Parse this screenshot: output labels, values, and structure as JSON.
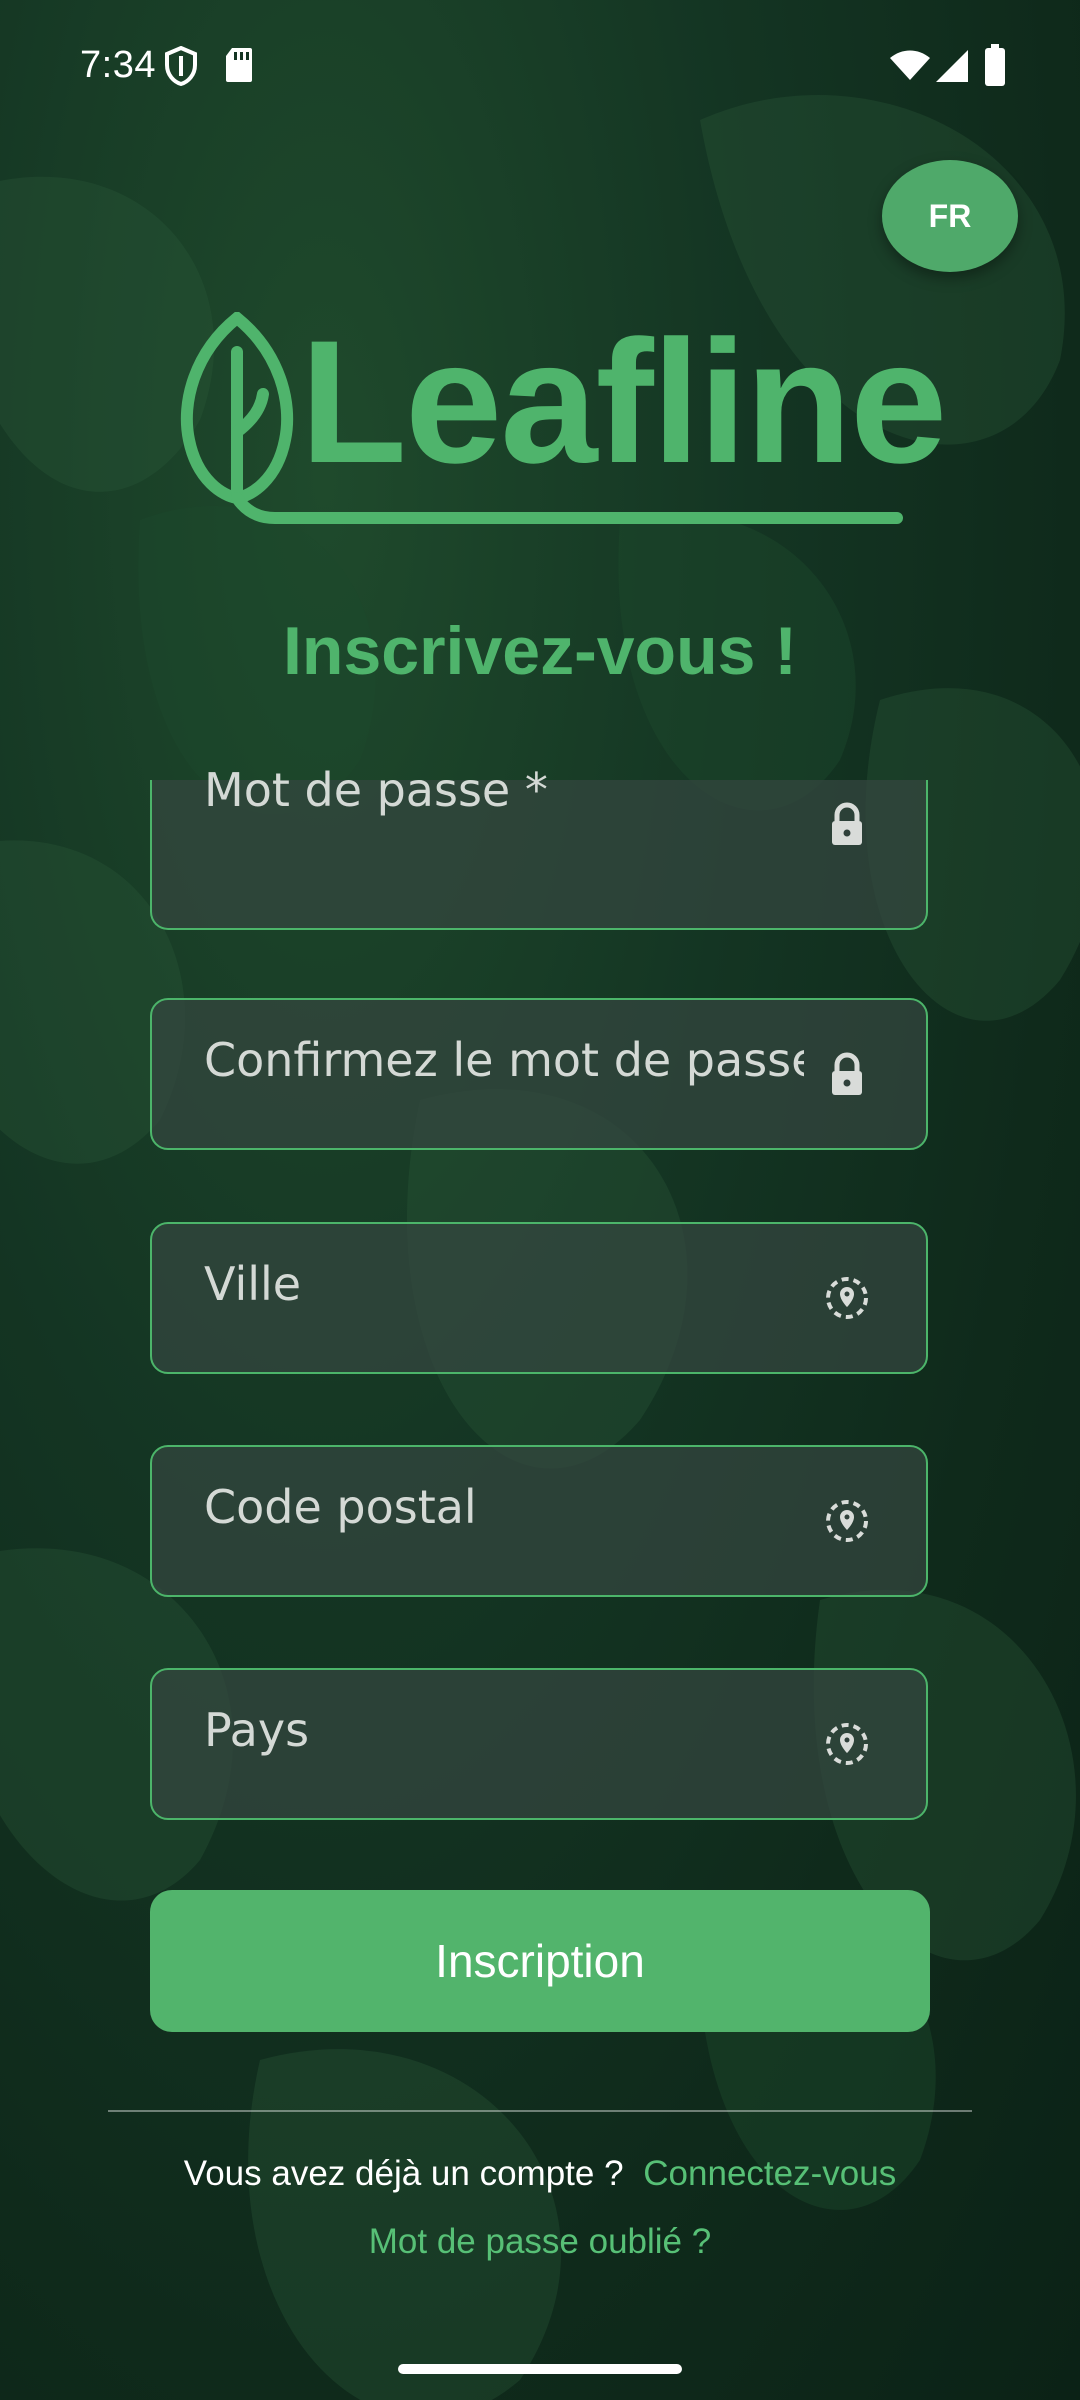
{
  "status_bar": {
    "time": "7:34"
  },
  "language": {
    "label": "FR"
  },
  "logo": {
    "text": "Leafline"
  },
  "page": {
    "title": "Inscrivez-vous !"
  },
  "form": {
    "password_placeholder": "Mot de passe *",
    "confirm_password_placeholder": "Confirmez le mot de passe",
    "city_placeholder": "Ville",
    "postal_code_placeholder": "Code postal",
    "country_placeholder": "Pays",
    "submit_label": "Inscription"
  },
  "footer": {
    "has_account_text": "Vous avez déjà un compte ?",
    "login_link": "Connectez-vous",
    "forgot_password_link": "Mot de passe oublié ?"
  },
  "colors": {
    "accent": "#4fb46c",
    "background": "#143523",
    "field_bg": "#344640"
  },
  "icons": [
    "shield-icon",
    "sd-card-icon",
    "wifi-icon",
    "signal-icon",
    "battery-icon",
    "lock-icon",
    "location-icon"
  ]
}
